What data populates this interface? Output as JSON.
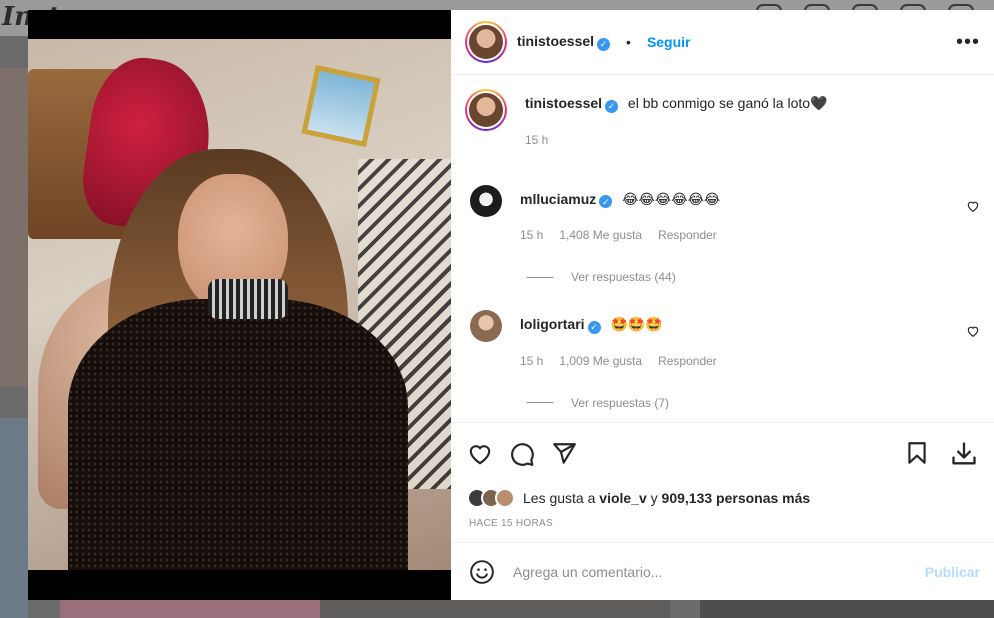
{
  "background": {
    "logo_fragment": "Inst"
  },
  "post": {
    "author": "tinistoessel",
    "follow_label": "Seguir",
    "more_label": "•••",
    "caption_text": "el bb conmigo se ganó la loto🖤",
    "caption_time": "15 h"
  },
  "comments": [
    {
      "user": "mlluciamuz",
      "text": "😂😂😂😂😂😂",
      "time": "15 h",
      "likes": "1,408 Me gusta",
      "reply_label": "Responder",
      "view_replies": "Ver respuestas (44)",
      "avatar_color": "#1c1c1c"
    },
    {
      "user": "loligortari",
      "text": "🤩🤩🤩",
      "time": "15 h",
      "likes": "1,009 Me gusta",
      "reply_label": "Responder",
      "view_replies": "Ver respuestas (7)",
      "avatar_color": "#d8b9a2"
    }
  ],
  "likes_line": {
    "prefix": "Les gusta a ",
    "user": "viole_v",
    "middle": " y ",
    "count": "909,133 personas más"
  },
  "time_ago": "HACE 15 HORAS",
  "comment_box": {
    "placeholder": "Agrega un comentario...",
    "publish_label": "Publicar"
  },
  "colors": {
    "accent": "#0095f6",
    "verified": "#3897f0",
    "publish_disabled": "#b3dbff",
    "muted": "#8e8e8e"
  },
  "icons": [
    "heart-icon",
    "comment-icon",
    "share-icon",
    "bookmark-icon",
    "download-icon",
    "emoji-icon",
    "verified-badge-icon",
    "more-options-icon"
  ]
}
